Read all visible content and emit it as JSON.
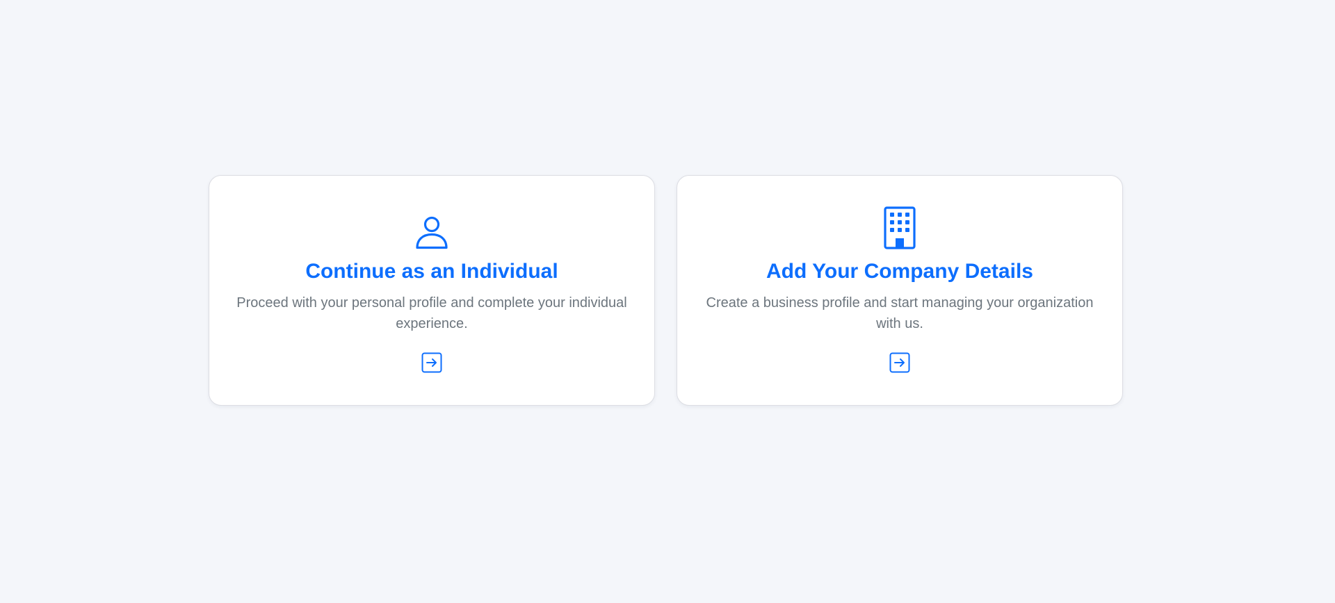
{
  "theme": {
    "accent": "#0d6efd",
    "text_muted": "#6c757d",
    "background": "#f4f6fa",
    "card_background": "#ffffff"
  },
  "cards": [
    {
      "icon": "person-icon",
      "title": "Continue as an Individual",
      "description": "Proceed with your personal profile and complete your individual experience.",
      "action_icon": "arrow-right-square-icon"
    },
    {
      "icon": "building-icon",
      "title": "Add Your Company Details",
      "description": "Create a business profile and start managing your organization with us.",
      "action_icon": "arrow-right-square-icon"
    }
  ]
}
